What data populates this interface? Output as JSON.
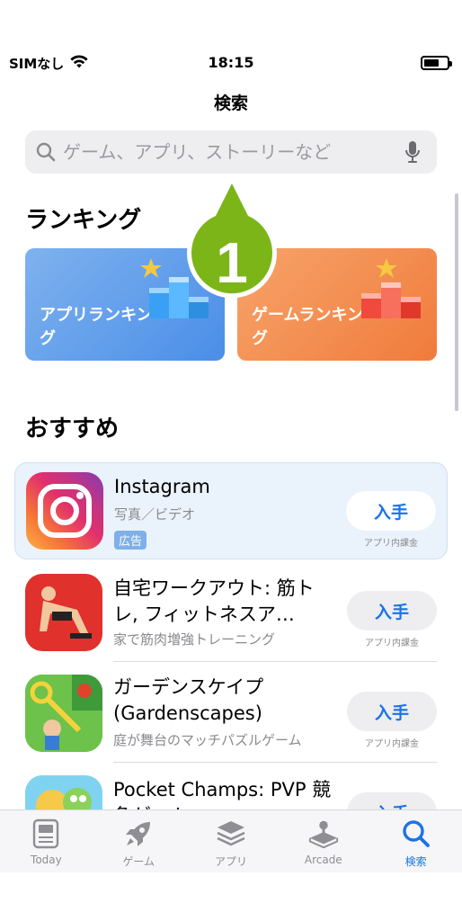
{
  "status_bar": {
    "carrier": "SIMなし",
    "time": "18:15"
  },
  "nav": {
    "title": "検索"
  },
  "search": {
    "placeholder": "ゲーム、アプリ、ストーリーなど"
  },
  "callout": {
    "number": "1"
  },
  "ranking": {
    "title": "ランキング",
    "cards": [
      {
        "label": "アプリランキング",
        "color": "#4a8ee8"
      },
      {
        "label": "ゲームランキング",
        "color": "#f07b3c"
      }
    ]
  },
  "recommended": {
    "title": "おすすめ",
    "apps": [
      {
        "name": "Instagram",
        "subtitle": "写真／ビデオ",
        "badge": "広告",
        "button": "入手",
        "iap": "アプリ内課金"
      },
      {
        "name": "自宅ワークアウト: 筋トレ, フィットネスア…",
        "subtitle": "家で筋肉増強トレーニング",
        "button": "入手",
        "iap": "アプリ内課金"
      },
      {
        "name": "ガーデンスケイプ (Gardenscapes)",
        "subtitle": "庭が舞台のマッチパズルゲーム",
        "button": "入手",
        "iap": "アプリ内課金"
      },
      {
        "name": "Pocket Champs: PVP 競争ゲーム",
        "button": "入手"
      }
    ]
  },
  "tabbar": {
    "tabs": [
      {
        "label": "Today",
        "icon": "today-icon"
      },
      {
        "label": "ゲーム",
        "icon": "rocket-icon"
      },
      {
        "label": "アプリ",
        "icon": "layers-icon"
      },
      {
        "label": "Arcade",
        "icon": "joystick-icon"
      },
      {
        "label": "検索",
        "icon": "search-icon",
        "active": true
      }
    ]
  },
  "colors": {
    "accent": "#1a73e8",
    "callout_green": "#7cb518"
  }
}
